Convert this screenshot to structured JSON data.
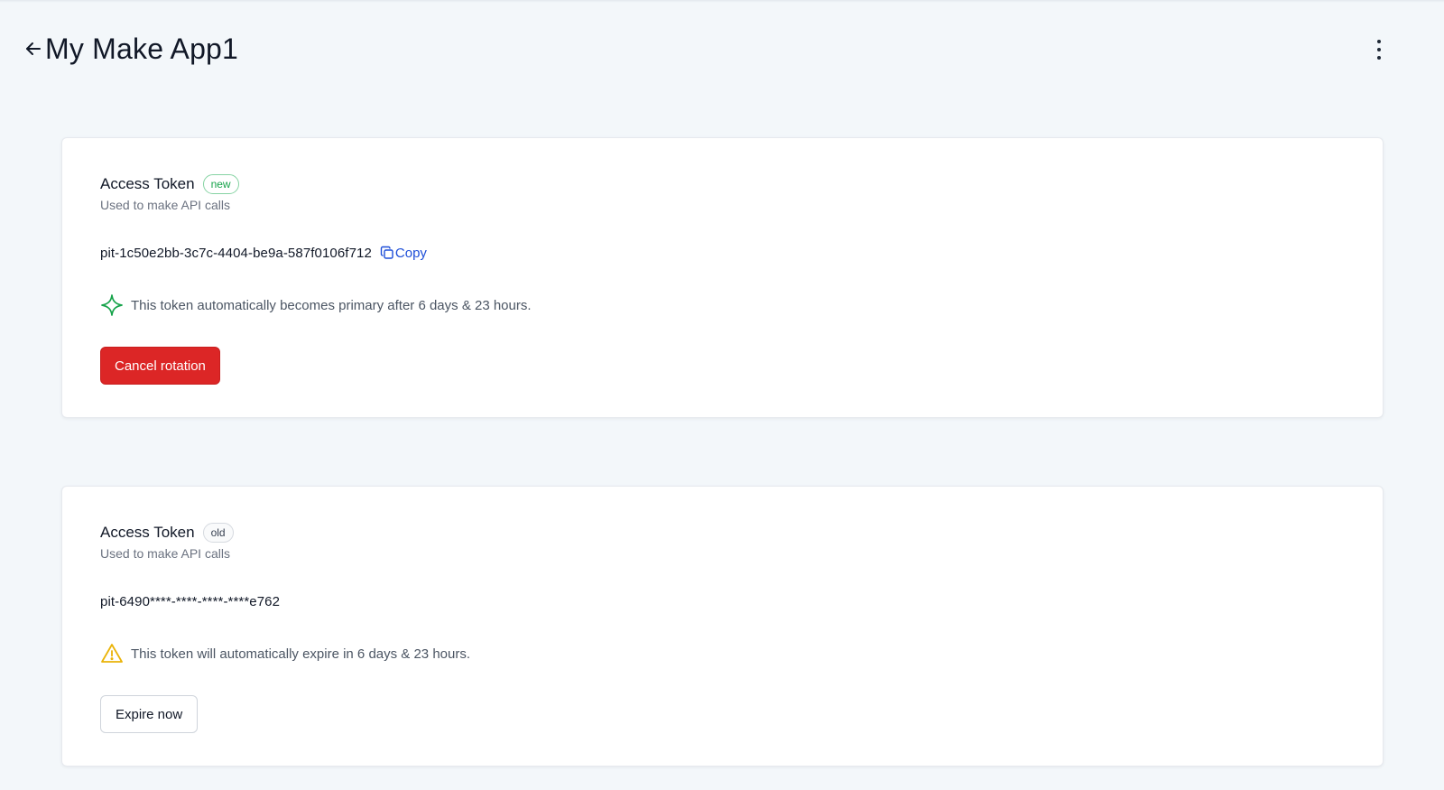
{
  "header": {
    "title": "My Make App1",
    "back_icon": "arrow-left-icon",
    "menu_icon": "more-vertical-icon"
  },
  "tokens": [
    {
      "title": "Access Token",
      "badge": "new",
      "subtitle": "Used to make API calls",
      "value": "pit-1c50e2bb-3c7c-4404-be9a-587f0106f712",
      "copy_label": "Copy",
      "notice_icon": "sparkle-icon",
      "notice": "This token automatically becomes primary after 6 days & 23 hours.",
      "action_label": "Cancel rotation"
    },
    {
      "title": "Access Token",
      "badge": "old",
      "subtitle": "Used to make API calls",
      "value": "pit-6490****-****-****-****e762",
      "notice_icon": "warning-icon",
      "notice": "This token will automatically expire in 6 days & 23 hours.",
      "action_label": "Expire now"
    }
  ],
  "colors": {
    "background": "#f3f7fa",
    "danger": "#dc2626",
    "link": "#1d4ed8",
    "success": "#16a34a",
    "warning": "#eab308"
  }
}
